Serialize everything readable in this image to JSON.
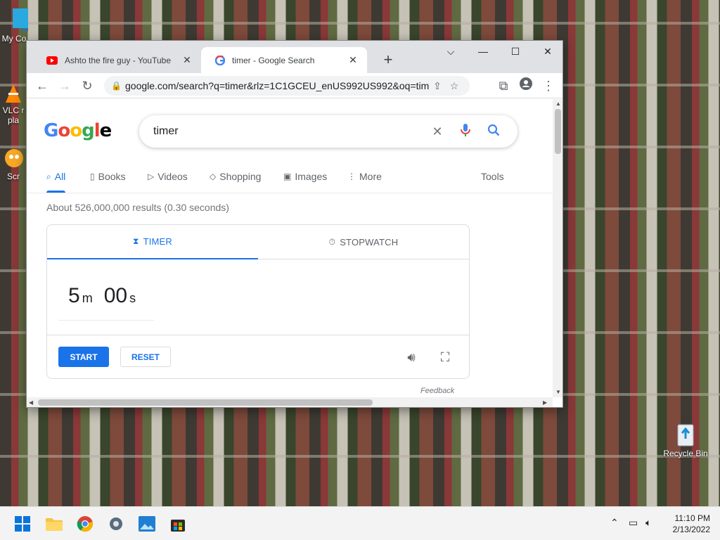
{
  "desktop": {
    "icons": {
      "my_computer": "My Co",
      "vlc_line1": "VLC r",
      "vlc_line2": "pla",
      "scratch": "Scr",
      "recycle_bin": "Recycle Bin"
    }
  },
  "browser": {
    "tabs": [
      {
        "title": "Ashto the fire guy - YouTube",
        "icon": "youtube-icon",
        "close": "✕"
      },
      {
        "title": "timer - Google Search",
        "icon": "google-icon",
        "close": "✕"
      }
    ],
    "new_tab": "+",
    "controls": {
      "dropdown": "⌵",
      "minimize": "—",
      "maximize": "☐",
      "close": "✕"
    },
    "address": "google.com/search?q=timer&rlz=1C1GCEU_enUS992US992&oq=time..."
  },
  "google": {
    "logo_letters": [
      "G",
      "o",
      "o",
      "g",
      "l",
      "e"
    ],
    "query": "timer",
    "nav": [
      {
        "label": "All",
        "icon": "search-icon"
      },
      {
        "label": "Books",
        "icon": "book-icon"
      },
      {
        "label": "Videos",
        "icon": "video-icon"
      },
      {
        "label": "Shopping",
        "icon": "tag-icon"
      },
      {
        "label": "Images",
        "icon": "image-icon"
      },
      {
        "label": "More",
        "icon": "more-icon"
      }
    ],
    "tools": "Tools",
    "stats": "About 526,000,000 results (0.30 seconds)",
    "timer_card": {
      "tab_timer": "TIMER",
      "tab_stopwatch": "STOPWATCH",
      "minutes": "5",
      "minutes_unit": "m",
      "seconds": "00",
      "seconds_unit": "s",
      "start": "START",
      "reset": "RESET"
    },
    "feedback": "Feedback"
  },
  "taskbar": {
    "time": "11:10 PM",
    "date": "2/13/2022"
  },
  "colors": {
    "accent": "#1a73e8",
    "youtube_red": "#ff0000"
  }
}
